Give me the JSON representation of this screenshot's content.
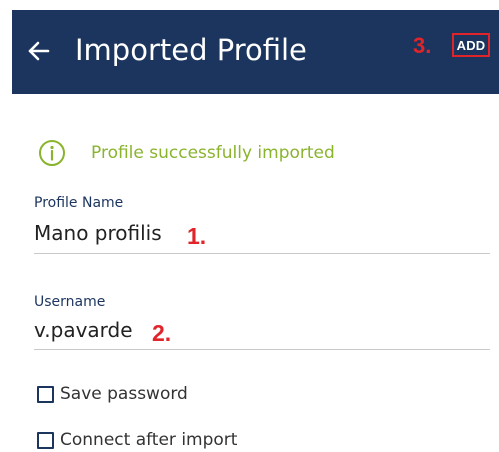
{
  "header": {
    "back_icon": "arrow-left-icon",
    "title": "Imported Profile",
    "add_annotation": "3.",
    "add_label": "ADD"
  },
  "message": {
    "icon": "info-circle-icon",
    "text": "Profile successfully imported"
  },
  "profile_name": {
    "label": "Profile Name",
    "value": "Mano profilis",
    "annotation": "1."
  },
  "username": {
    "label": "Username",
    "value": "v.pavarde",
    "annotation": "2."
  },
  "checkboxes": [
    {
      "label": "Save password",
      "checked": false
    },
    {
      "label": "Connect after import",
      "checked": false
    }
  ],
  "colors": {
    "header_bg": "#1b355e",
    "annotation_red": "#e0242a",
    "success_green": "#8ab42e",
    "label_blue": "#1b355e"
  }
}
